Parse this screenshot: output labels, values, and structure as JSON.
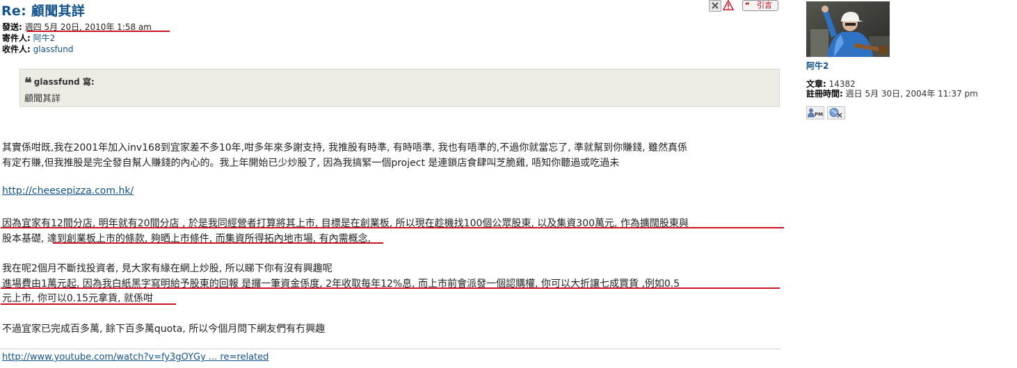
{
  "post": {
    "title": "Re: 顧聞其詳",
    "quote_btn_label": "引言",
    "meta": {
      "sent_label": "發送:",
      "sent_value": "週四 5月 20日, 2010年 1:58 am",
      "sender_label": "寄件人:",
      "sender_value": "阿牛2",
      "recipient_label": "收件人:",
      "recipient_value": "glassfund"
    },
    "quote": {
      "cite": "glassfund 寫:",
      "text": "顧聞其詳"
    },
    "paragraphs": [
      "其實係咁既,我在2001年加入inv168到宜家差不多10年,咁多年來多謝支持, 我推股有時準, 有時唔準, 我也有唔準的,不過你就當忘了, 準就幫到你賺錢, 雖然真係",
      "有定冇賺,但我推股是完全發自幫人賺錢的內心的。我上年開始已少炒股了, 因為我搞緊一個project 是連鎖店食肆叫芝脆雞, 唔知你聽過或吃過未",
      "http://cheesepizza.com.hk/",
      "因為宜家有12間分店, 明年就有20間分店 , 於是我同經營者打算將其上市, 目標是在創業板, 所以現在趁機找100個公眾股東, 以及集資300萬元, 作為擴闊股東與",
      "股本基礎, 達到創業板上市的條款, 夠晒上市條件, 而集資所得拓內地市場, 有內需概念,",
      "我在呢2個月不斷找投資者, 見大家有緣在網上炒股, 所以睇下你有沒有興趣呢",
      "進場費由1萬元起, 因為我白紙黑字寫明給予股東的回報 是攞一筆資金係度, 2年收取每年12%息, 而上市前會派發一個認購權, 你可以大折讓七成買貨 ,例如0.5",
      "元上市, 你可以0.15元拿貨, 就係咁",
      "不過宜家已完成百多萬, 餘下百多萬quota, 所以今個月問下網友們有冇興趣"
    ],
    "signature_link": "http://www.youtube.com/watch?v=fy3gOYGy ... re=related"
  },
  "profile": {
    "username": "阿牛2",
    "posts_label": "文章:",
    "posts_value": "14382",
    "joined_label": "註冊時間:",
    "joined_value": "週日 5月 30日, 2004年 11:37 pm"
  },
  "colors": {
    "link": "#105289",
    "annotation_red": "#cc1122",
    "quote_bg": "#ecebe4"
  },
  "icons": [
    "delete-icon",
    "report-icon",
    "quote-icon",
    "pm-icon",
    "www-icon"
  ]
}
